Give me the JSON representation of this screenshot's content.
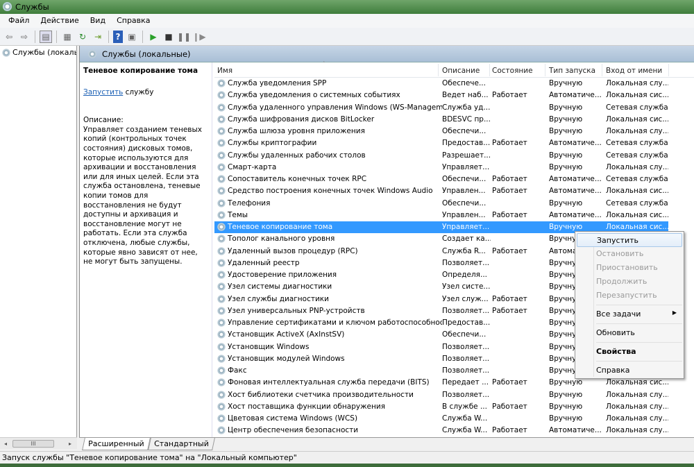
{
  "window": {
    "title": "Службы"
  },
  "menu": [
    "Файл",
    "Действие",
    "Вид",
    "Справка"
  ],
  "toolbar": [
    "back-icon",
    "forward-icon",
    "show-hide-tree-icon",
    "properties-icon",
    "refresh-icon",
    "export-icon",
    "help-icon",
    "console-icon",
    "play-icon",
    "stop-icon",
    "pause-icon",
    "resume-icon"
  ],
  "tree": {
    "root": "Службы (локалы"
  },
  "panel": {
    "title": "Службы (локальные)"
  },
  "detail": {
    "title": "Теневое копирование тома",
    "start_link": "Запустить",
    "start_suffix": " службу",
    "desc_label": "Описание:",
    "desc": "Управляет созданием теневых копий (контрольных точек состояния) дисковых томов, которые используются для архивации и восстановления или для иных целей. Если эта служба остановлена, теневые копии томов для восстановления не будут доступны и архивация и восстановление могут не работать. Если эта служба отключена, любые службы, которые явно зависят от нее, не могут быть запущены."
  },
  "columns": [
    "Имя",
    "Описание",
    "Состояние",
    "Тип запуска",
    "Вход от имени"
  ],
  "rows": [
    [
      "Служба уведомления SPP",
      "Обеспече...",
      "",
      "Вручную",
      "Локальная слу..."
    ],
    [
      "Служба уведомления о системных событиях",
      "Ведет наб...",
      "Работает",
      "Автоматиче...",
      "Локальная сис..."
    ],
    [
      "Служба удаленного управления Windows (WS-Manageme...",
      "Служба уд...",
      "",
      "Вручную",
      "Сетевая служба"
    ],
    [
      "Служба шифрования дисков BitLocker",
      "BDESVC пр...",
      "",
      "Вручную",
      "Локальная сис..."
    ],
    [
      "Служба шлюза уровня приложения",
      "Обеспечи...",
      "",
      "Вручную",
      "Локальная слу..."
    ],
    [
      "Службы криптографии",
      "Предостав...",
      "Работает",
      "Автоматиче...",
      "Сетевая служба"
    ],
    [
      "Службы удаленных рабочих столов",
      "Разрешает...",
      "",
      "Вручную",
      "Сетевая служба"
    ],
    [
      "Смарт-карта",
      "Управляет...",
      "",
      "Вручную",
      "Локальная слу..."
    ],
    [
      "Сопоставитель конечных точек RPC",
      "Обеспечи...",
      "Работает",
      "Автоматиче...",
      "Сетевая служба"
    ],
    [
      "Средство построения конечных точек Windows Audio",
      "Управлен...",
      "Работает",
      "Автоматиче...",
      "Локальная сис..."
    ],
    [
      "Телефония",
      "Обеспечи...",
      "",
      "Вручную",
      "Сетевая служба"
    ],
    [
      "Темы",
      "Управлен...",
      "Работает",
      "Автоматиче...",
      "Локальная сис..."
    ],
    [
      "Теневое копирование тома",
      "Управляет...",
      "",
      "Вручную",
      "Локальная сис..."
    ],
    [
      "Тополог канального уровня",
      "Создает ка...",
      "",
      "Вручную",
      ""
    ],
    [
      "Удаленный вызов процедур (RPC)",
      "Служба R...",
      "Работает",
      "Автоматиче...",
      ""
    ],
    [
      "Удаленный реестр",
      "Позволяет...",
      "",
      "Вручную",
      ""
    ],
    [
      "Удостоверение приложения",
      "Определя...",
      "",
      "Вручную",
      ""
    ],
    [
      "Узел системы диагностики",
      "Узел систе...",
      "",
      "Вручную",
      ""
    ],
    [
      "Узел службы диагностики",
      "Узел служ...",
      "Работает",
      "Вручную",
      ""
    ],
    [
      "Узел универсальных PNP-устройств",
      "Позволяет...",
      "Работает",
      "Вручную",
      ""
    ],
    [
      "Управление сертификатами и ключом работоспособности",
      "Предостав...",
      "",
      "Вручную",
      ""
    ],
    [
      "Установщик ActiveX (AxInstSV)",
      "Обеспечи...",
      "",
      "Вручную",
      ""
    ],
    [
      "Установщик Windows",
      "Позволяет...",
      "",
      "Вручную",
      ""
    ],
    [
      "Установщик модулей Windows",
      "Позволяет...",
      "",
      "Вручную",
      ""
    ],
    [
      "Факс",
      "Позволяет...",
      "",
      "Вручную",
      ""
    ],
    [
      "Фоновая интеллектуальная служба передачи (BITS)",
      "Передает ...",
      "Работает",
      "Вручную",
      "Локальная сис..."
    ],
    [
      "Хост библиотеки счетчика производительности",
      "Позволяет...",
      "",
      "Вручную",
      "Локальная слу..."
    ],
    [
      "Хост поставщика функции обнаружения",
      "В службе ...",
      "Работает",
      "Вручную",
      "Локальная слу..."
    ],
    [
      "Цветовая система Windows (WCS)",
      "Служба W...",
      "",
      "Вручную",
      "Локальная слу..."
    ],
    [
      "Центр обеспечения безопасности",
      "Служба W...",
      "Работает",
      "Автоматиче...",
      "Локальная слу..."
    ]
  ],
  "selected_row": 12,
  "context_menu": [
    {
      "label": "Запустить",
      "state": "highlighted"
    },
    {
      "label": "Остановить",
      "state": "disabled"
    },
    {
      "label": "Приостановить",
      "state": "disabled"
    },
    {
      "label": "Продолжить",
      "state": "disabled"
    },
    {
      "label": "Перезапустить",
      "state": "disabled"
    },
    {
      "sep": true
    },
    {
      "label": "Все задачи",
      "state": "submenu"
    },
    {
      "sep": true
    },
    {
      "label": "Обновить",
      "state": "normal"
    },
    {
      "sep": true
    },
    {
      "label": "Свойства",
      "state": "bold"
    },
    {
      "sep": true
    },
    {
      "label": "Справка",
      "state": "normal"
    }
  ],
  "tabs": [
    "Расширенный",
    "Стандартный"
  ],
  "status": "Запуск службы \"Теневое копирование тома\" на \"Локальный компьютер\"",
  "colors": {
    "selection": "#3399ff",
    "title_bar": "#4f8c4b",
    "panel_header": "#b8cade"
  }
}
